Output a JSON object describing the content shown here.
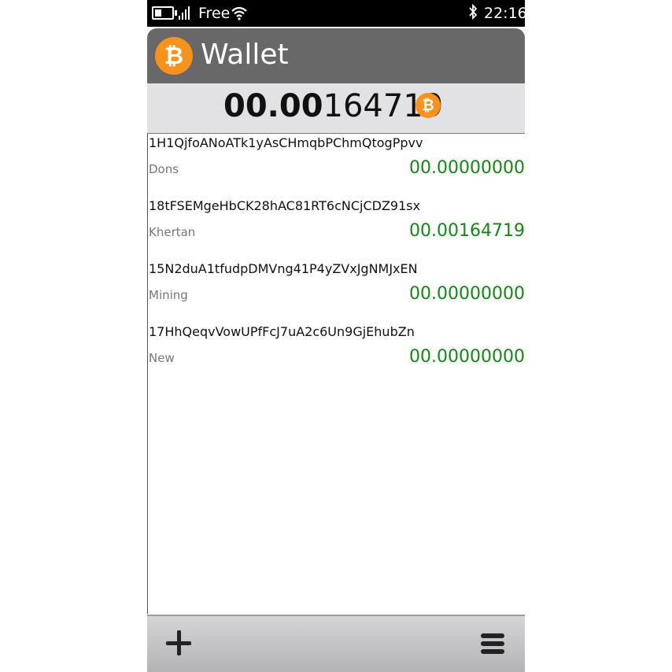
{
  "status_bar": {
    "carrier": "Free",
    "time": "22:16",
    "icons": [
      "battery-icon",
      "signal-icon",
      "wifi-icon",
      "bluetooth-icon"
    ]
  },
  "header": {
    "logo_symbol": "₿",
    "title": "Wallet"
  },
  "balance": {
    "bold_part": "00.00",
    "regular_part": "164719",
    "coin_symbol": "₿"
  },
  "addresses": [
    {
      "address": "1H1QjfoANoATk1yAsCHmqbPChmQtogPpvv",
      "label": "Dons",
      "amount": "00.00000000"
    },
    {
      "address": "18tFSEMgeHbCK28hAC81RT6cNCjCDZ91sx",
      "label": "Khertan",
      "amount": "00.00164719"
    },
    {
      "address": "15N2duA1tfudpDMVng41P4yZVxJgNMJxEN",
      "label": "Mining",
      "amount": "00.00000000"
    },
    {
      "address": "17HhQeqvVowUPfFcJ7uA2c6Un9GjEhubZn",
      "label": "New",
      "amount": "00.00000000"
    }
  ],
  "toolbar": {
    "add_icon": "plus-icon",
    "menu_icon": "menu-icon"
  },
  "colors": {
    "accent": "#f7931a",
    "amount": "#118a11",
    "header_bg": "#686868"
  }
}
